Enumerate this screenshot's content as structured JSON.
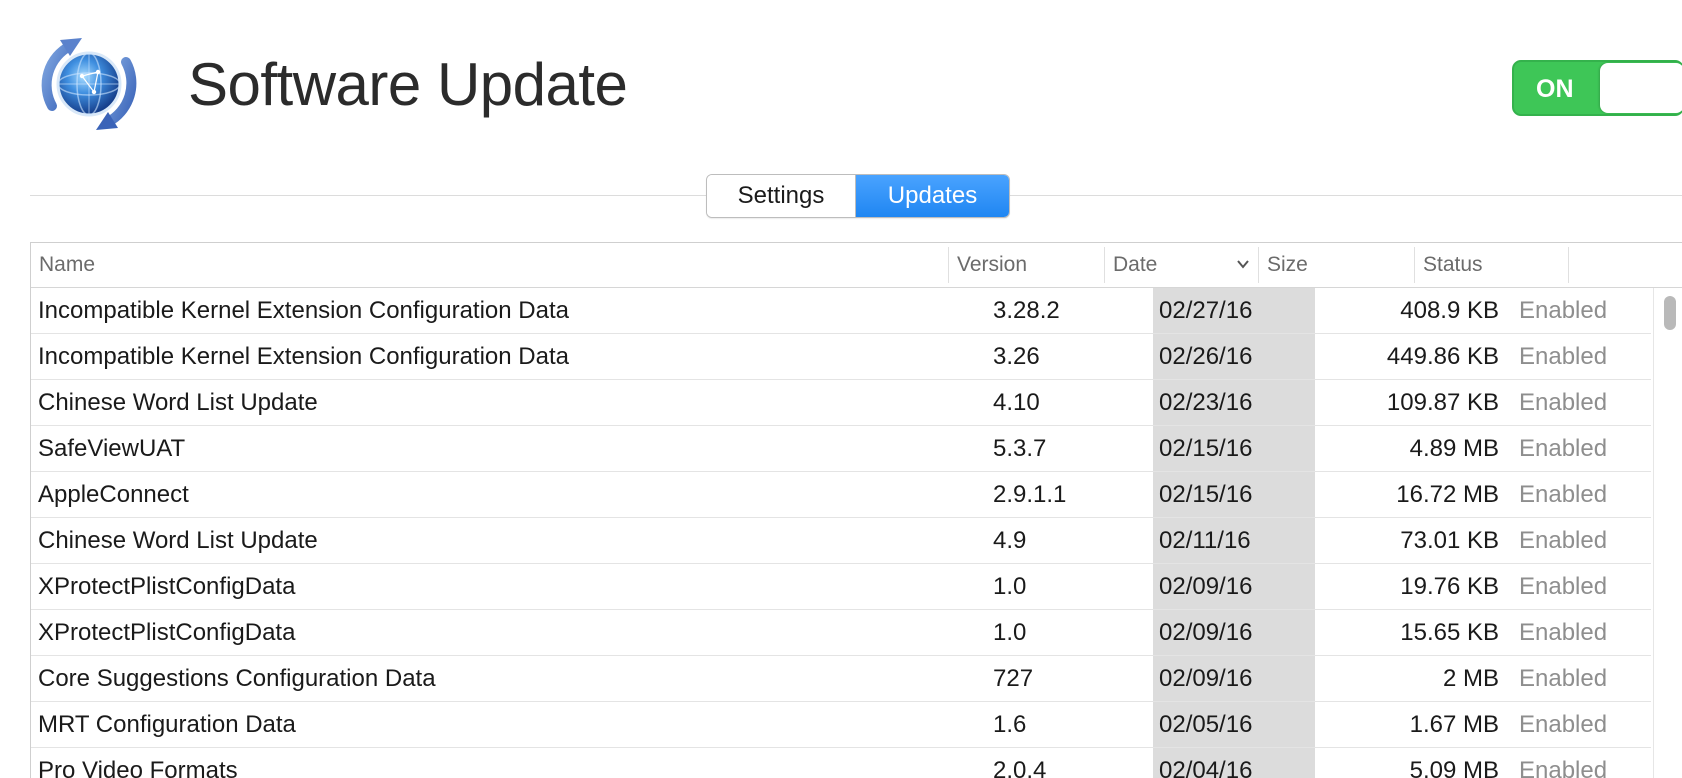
{
  "app": {
    "title": "Software Update",
    "icon": "software-update-icon"
  },
  "toggle": {
    "label": "ON",
    "state": "on",
    "color": "#3ec657"
  },
  "tabs": [
    {
      "label": "Settings",
      "selected": false
    },
    {
      "label": "Updates",
      "selected": true
    }
  ],
  "table": {
    "columns": {
      "name": "Name",
      "version": "Version",
      "date": "Date",
      "size": "Size",
      "status": "Status"
    },
    "sorted_by": "Date",
    "sort_icon": "chevron-down-icon",
    "rows": [
      {
        "name": "Incompatible Kernel Extension Configuration Data",
        "version": "3.28.2",
        "date": "02/27/16",
        "size": "408.9 KB",
        "status": "Enabled"
      },
      {
        "name": "Incompatible Kernel Extension Configuration Data",
        "version": "3.26",
        "date": "02/26/16",
        "size": "449.86 KB",
        "status": "Enabled"
      },
      {
        "name": "Chinese Word List Update",
        "version": "4.10",
        "date": "02/23/16",
        "size": "109.87 KB",
        "status": "Enabled"
      },
      {
        "name": "SafeViewUAT",
        "version": "5.3.7",
        "date": "02/15/16",
        "size": "4.89 MB",
        "status": "Enabled"
      },
      {
        "name": "AppleConnect",
        "version": "2.9.1.1",
        "date": "02/15/16",
        "size": "16.72 MB",
        "status": "Enabled"
      },
      {
        "name": "Chinese Word List Update",
        "version": "4.9",
        "date": "02/11/16",
        "size": "73.01 KB",
        "status": "Enabled"
      },
      {
        "name": "XProtectPlistConfigData",
        "version": "1.0",
        "date": "02/09/16",
        "size": "19.76 KB",
        "status": "Enabled"
      },
      {
        "name": "XProtectPlistConfigData",
        "version": "1.0",
        "date": "02/09/16",
        "size": "15.65 KB",
        "status": "Enabled"
      },
      {
        "name": "Core Suggestions Configuration Data",
        "version": "727",
        "date": "02/09/16",
        "size": "2 MB",
        "status": "Enabled"
      },
      {
        "name": "MRT Configuration Data",
        "version": "1.6",
        "date": "02/05/16",
        "size": "1.67 MB",
        "status": "Enabled"
      },
      {
        "name": "Pro Video Formats",
        "version": "2.0.4",
        "date": "02/04/16",
        "size": "5.09 MB",
        "status": "Enabled"
      }
    ]
  },
  "colors": {
    "accent": "#1f86f2",
    "toggle_on": "#3ec657",
    "sorted_column_bg": "#dcdcdc",
    "status_text": "#8e8e8e"
  }
}
